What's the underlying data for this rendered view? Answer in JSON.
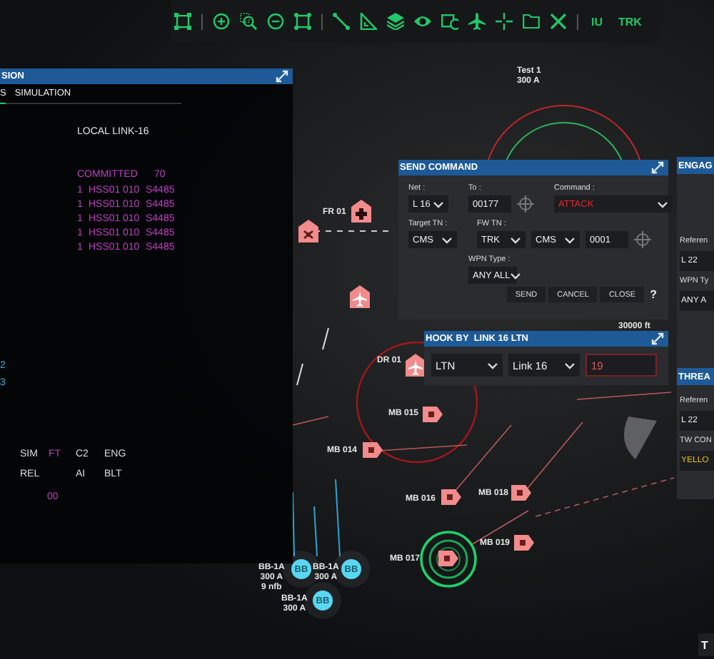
{
  "toolbar": {
    "buttons": [
      "IU",
      "TRK"
    ]
  },
  "mission_panel": {
    "title": "SION",
    "tabs": [
      {
        "label": "S",
        "selected": true
      },
      {
        "label": "SIMULATION",
        "selected": false
      }
    ],
    "edge_marks": [
      {
        "text": "2",
        "color": "#2bb5d8"
      },
      {
        "text": "3",
        "color": "#2bb5d8"
      }
    ],
    "source": "LOCAL LINK-16",
    "committed_label": "COMMITTED",
    "committed_count": "70",
    "committed_rows": [
      [
        "1",
        "HSS01",
        "010",
        "S4485"
      ],
      [
        "1",
        "HSS01",
        "010",
        "S4485"
      ],
      [
        "1",
        "HSS01",
        "010",
        "S4485"
      ],
      [
        "1",
        "HSS01",
        "010",
        "S4485"
      ],
      [
        "1",
        "HSS01",
        "010",
        "S4485"
      ]
    ],
    "status_rows": [
      [
        {
          "text": "SIM",
          "active": false
        },
        {
          "text": "FT",
          "active": true
        },
        {
          "text": "C2",
          "active": false
        },
        {
          "text": "ENG",
          "active": false
        }
      ],
      [
        {
          "text": "REL",
          "active": false
        },
        null,
        {
          "text": "AI",
          "active": false
        },
        {
          "text": "BLT",
          "active": false
        }
      ]
    ],
    "code": "00"
  },
  "send_command": {
    "title": "SEND COMMAND",
    "net": {
      "label": "Net :",
      "value": "L 16"
    },
    "to": {
      "label": "To :",
      "value": "00177"
    },
    "command": {
      "label": "Command :",
      "value": "ATTACK"
    },
    "target_tn": {
      "label": "Target TN :",
      "value": "CMS"
    },
    "fw_tn": {
      "label": "FW TN :",
      "values": [
        "TRK",
        "CMS"
      ],
      "number": "0001"
    },
    "wpn_type": {
      "label": "WPN Type :",
      "value": "ANY ALL"
    },
    "buttons": [
      "SEND",
      "CANCEL",
      "CLOSE"
    ],
    "help": "?"
  },
  "hook": {
    "title": "HOOK BY  LINK 16 LTN",
    "selects": [
      "LTN",
      "Link 16"
    ],
    "value": "19",
    "invalid": true
  },
  "engage": {
    "title": "ENGAG",
    "reference_label": "Referen",
    "reference": "L 22",
    "wpn_label": "WPN Ty",
    "wpn": "ANY A"
  },
  "threat": {
    "title": "THREA",
    "reference_label": "Referen",
    "reference": "L 22",
    "tw_label": "TW CON",
    "tw": "YELLO"
  },
  "corner_tile": "T",
  "map": {
    "markers": [
      {
        "kind": "label",
        "lines": [
          "Test 1",
          "300 A"
        ]
      },
      {
        "kind": "hospital",
        "lines": [
          "FR 01"
        ]
      },
      {
        "kind": "station"
      },
      {
        "kind": "aircraft"
      },
      {
        "kind": "aircraft",
        "lines": [
          "DR 01"
        ]
      },
      {
        "kind": "boat",
        "lines": [
          "MB 015"
        ],
        "engaged": false
      },
      {
        "kind": "boat",
        "lines": [
          "MB 014"
        ],
        "engaged": false
      },
      {
        "kind": "boat",
        "lines": [
          "MB 016"
        ],
        "engaged": false
      },
      {
        "kind": "boat",
        "lines": [
          "MB 018"
        ],
        "engaged": false
      },
      {
        "kind": "boat",
        "lines": [
          "MB 019"
        ],
        "engaged": false
      },
      {
        "kind": "boat",
        "lines": [
          "MB 017"
        ],
        "engaged": true
      },
      {
        "kind": "bb",
        "badge": "BB",
        "lines": [
          "BB-1A",
          "300 A",
          "9 nfb"
        ]
      },
      {
        "kind": "bb",
        "badge": "BB",
        "lines": [
          "BB-1A",
          "300 A"
        ]
      },
      {
        "kind": "bb",
        "badge": "BB",
        "lines": [
          "BB-1A",
          "300 A"
        ]
      },
      {
        "kind": "label",
        "lines": [
          "30000 ft"
        ]
      }
    ]
  }
}
